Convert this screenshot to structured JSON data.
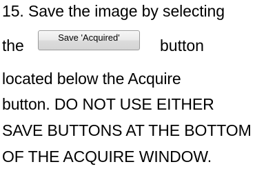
{
  "instruction": {
    "line1": "15.  Save the image by selecting",
    "line2_prefix": "the",
    "button_label": "Save 'Acquired'",
    "line2_suffix": "button",
    "line3": "located below the Acquire",
    "line4": "button.  DO NOT USE EITHER",
    "line5": "SAVE BUTTONS AT THE BOTTOM",
    "line6": "OF THE ACQUIRE WINDOW."
  }
}
